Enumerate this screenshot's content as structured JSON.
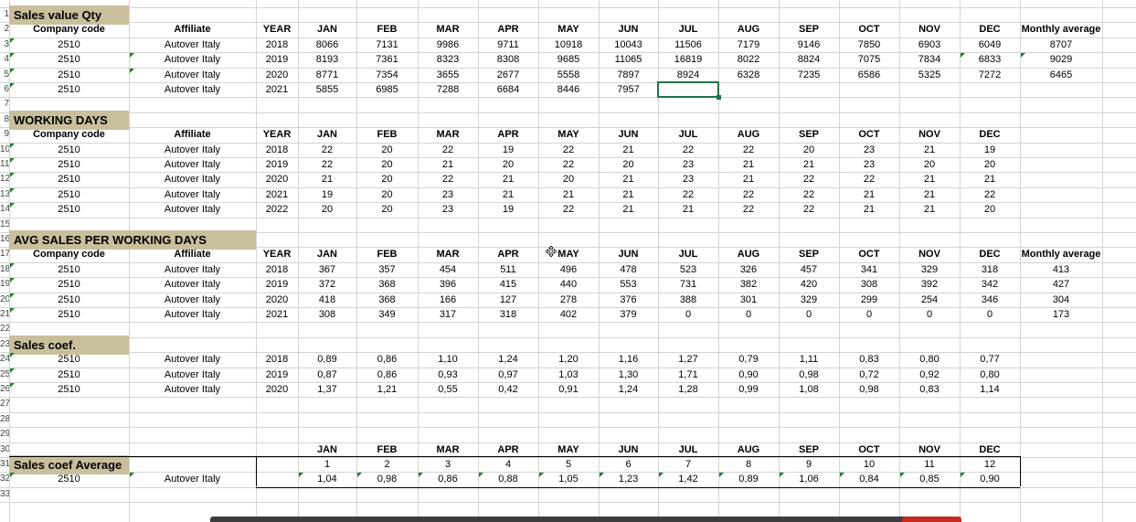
{
  "row_numbers": [
    "1",
    "2",
    "3",
    "4",
    "5",
    "6",
    "7",
    "8",
    "9",
    "10",
    "11",
    "12",
    "13",
    "14",
    "15",
    "16",
    "17",
    "18",
    "19",
    "20",
    "21",
    "22",
    "23",
    "24",
    "25",
    "26",
    "27",
    "28",
    "29",
    "30",
    "31",
    "32",
    "33"
  ],
  "months": [
    "JAN",
    "FEB",
    "MAR",
    "APR",
    "MAY",
    "JUN",
    "JUL",
    "AUG",
    "SEP",
    "OCT",
    "NOV",
    "DEC"
  ],
  "headers": {
    "company_code": "Company code",
    "affiliate": "Affiliate",
    "year": "YEAR",
    "monthly_average": "Monthly average"
  },
  "sections": {
    "sales_value": {
      "title": "Sales value Qty",
      "rows": [
        {
          "code": "2510",
          "affiliate": "Autover Italy",
          "year": "2018",
          "values": [
            "8066",
            "7131",
            "9986",
            "9711",
            "10918",
            "10043",
            "11506",
            "7179",
            "9146",
            "7850",
            "6903",
            "6049"
          ],
          "avg": "8707"
        },
        {
          "code": "2510",
          "affiliate": "Autover Italy",
          "year": "2019",
          "values": [
            "8193",
            "7361",
            "8323",
            "8308",
            "9685",
            "11065",
            "16819",
            "8022",
            "8824",
            "7075",
            "7834",
            "6833"
          ],
          "avg": "9029"
        },
        {
          "code": "2510",
          "affiliate": "Autover Italy",
          "year": "2020",
          "values": [
            "8771",
            "7354",
            "3655",
            "2677",
            "5558",
            "7897",
            "8924",
            "6328",
            "7235",
            "6586",
            "5325",
            "7272"
          ],
          "avg": "6465"
        },
        {
          "code": "2510",
          "affiliate": "Autover Italy",
          "year": "2021",
          "values": [
            "5855",
            "6985",
            "7288",
            "6684",
            "8446",
            "7957",
            "",
            "",
            "",
            "",
            "",
            ""
          ],
          "avg": ""
        }
      ]
    },
    "working_days": {
      "title": "WORKING DAYS",
      "rows": [
        {
          "code": "2510",
          "affiliate": "Autover Italy",
          "year": "2018",
          "values": [
            "22",
            "20",
            "22",
            "19",
            "22",
            "21",
            "22",
            "22",
            "20",
            "23",
            "21",
            "19"
          ]
        },
        {
          "code": "2510",
          "affiliate": "Autover Italy",
          "year": "2019",
          "values": [
            "22",
            "20",
            "21",
            "20",
            "22",
            "20",
            "23",
            "21",
            "21",
            "23",
            "20",
            "20"
          ]
        },
        {
          "code": "2510",
          "affiliate": "Autover Italy",
          "year": "2020",
          "values": [
            "21",
            "20",
            "22",
            "21",
            "20",
            "21",
            "23",
            "21",
            "22",
            "22",
            "21",
            "21"
          ]
        },
        {
          "code": "2510",
          "affiliate": "Autover Italy",
          "year": "2021",
          "values": [
            "19",
            "20",
            "23",
            "21",
            "21",
            "21",
            "22",
            "22",
            "22",
            "21",
            "21",
            "22"
          ]
        },
        {
          "code": "2510",
          "affiliate": "Autover Italy",
          "year": "2022",
          "values": [
            "20",
            "20",
            "23",
            "19",
            "22",
            "21",
            "21",
            "22",
            "22",
            "21",
            "21",
            "20"
          ]
        }
      ]
    },
    "avg_sales": {
      "title": "AVG SALES PER WORKING DAYS",
      "rows": [
        {
          "code": "2510",
          "affiliate": "Autover Italy",
          "year": "2018",
          "values": [
            "367",
            "357",
            "454",
            "511",
            "496",
            "478",
            "523",
            "326",
            "457",
            "341",
            "329",
            "318"
          ],
          "avg": "413"
        },
        {
          "code": "2510",
          "affiliate": "Autover Italy",
          "year": "2019",
          "values": [
            "372",
            "368",
            "396",
            "415",
            "440",
            "553",
            "731",
            "382",
            "420",
            "308",
            "392",
            "342"
          ],
          "avg": "427"
        },
        {
          "code": "2510",
          "affiliate": "Autover Italy",
          "year": "2020",
          "values": [
            "418",
            "368",
            "166",
            "127",
            "278",
            "376",
            "388",
            "301",
            "329",
            "299",
            "254",
            "346"
          ],
          "avg": "304"
        },
        {
          "code": "2510",
          "affiliate": "Autover Italy",
          "year": "2021",
          "values": [
            "308",
            "349",
            "317",
            "318",
            "402",
            "379",
            "0",
            "0",
            "0",
            "0",
            "0",
            "0"
          ],
          "avg": "173"
        }
      ]
    },
    "sales_coef": {
      "title": "Sales coef.",
      "rows": [
        {
          "code": "2510",
          "affiliate": "Autover Italy",
          "year": "2018",
          "values": [
            "0,89",
            "0,86",
            "1,10",
            "1,24",
            "1,20",
            "1,16",
            "1,27",
            "0,79",
            "1,11",
            "0,83",
            "0,80",
            "0,77"
          ]
        },
        {
          "code": "2510",
          "affiliate": "Autover Italy",
          "year": "2019",
          "values": [
            "0,87",
            "0,86",
            "0,93",
            "0,97",
            "1,03",
            "1,30",
            "1,71",
            "0,90",
            "0,98",
            "0,72",
            "0,92",
            "0,80"
          ]
        },
        {
          "code": "2510",
          "affiliate": "Autover Italy",
          "year": "2020",
          "values": [
            "1,37",
            "1,21",
            "0,55",
            "0,42",
            "0,91",
            "1,24",
            "1,28",
            "0,99",
            "1,08",
            "0,98",
            "0,83",
            "1,14"
          ]
        }
      ]
    },
    "coef_average": {
      "title": "Sales coef Average",
      "month_numbers": [
        "1",
        "2",
        "3",
        "4",
        "5",
        "6",
        "7",
        "8",
        "9",
        "10",
        "11",
        "12"
      ],
      "row": {
        "code": "2510",
        "affiliate": "Autover Italy",
        "values": [
          "1,04",
          "0,98",
          "0,86",
          "0,88",
          "1,05",
          "1,23",
          "1,42",
          "0,89",
          "1,06",
          "0,84",
          "0,85",
          "0,90"
        ]
      }
    }
  },
  "colors": {
    "title_fill": "#c9bf9c",
    "selection": "#217346",
    "error_triangle": "#1e7e34",
    "gridline": "#d4d4d4"
  },
  "cursor_icon": "move-cursor-icon"
}
